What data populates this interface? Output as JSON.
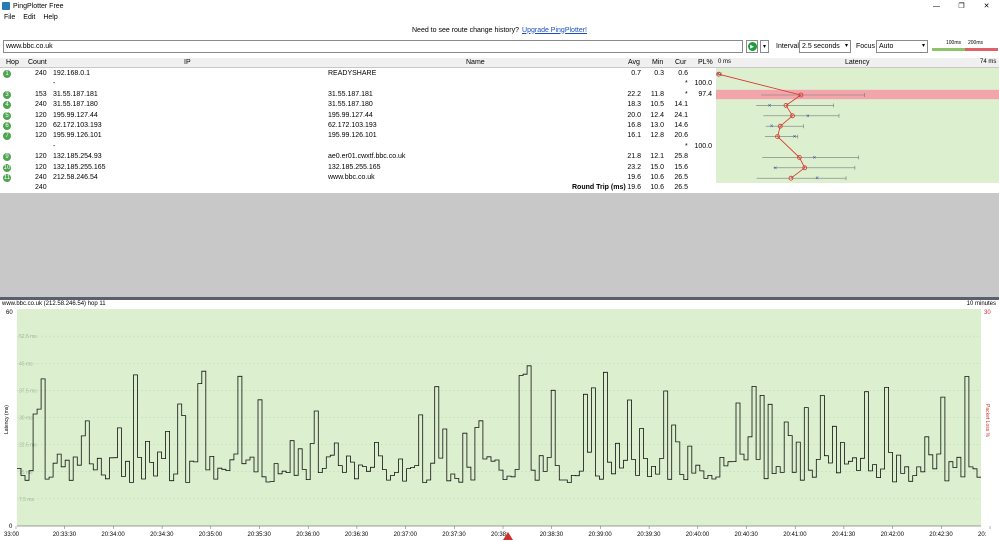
{
  "app": {
    "title": "PingPlotter Free",
    "minimize_glyph": "—",
    "maximize_glyph": "❐",
    "close_glyph": "✕"
  },
  "menu": [
    "File",
    "Edit",
    "Help"
  ],
  "promo": {
    "text": "Need to see route change history?",
    "link": "Upgrade PingPlotter!"
  },
  "toolbar": {
    "target": "www.bbc.co.uk",
    "interval_label": "Interval",
    "interval_value": "2.5 seconds",
    "focus_label": "Focus",
    "focus_value": "Auto",
    "scale_100": "100ms",
    "scale_200": "200ms"
  },
  "table": {
    "headers": [
      "Hop",
      "Count",
      "IP",
      "Name",
      "Avg",
      "Min",
      "Cur",
      "PL%",
      "Latency"
    ],
    "latency_min": "0 ms",
    "latency_max": "74 ms",
    "rows": [
      {
        "hop": "1",
        "count": "240",
        "ip": "192.168.0.1",
        "name": "READYSHARE",
        "avg": "0.7",
        "min": "0.3",
        "cur": "0.6",
        "pl": "",
        "star": ""
      },
      {
        "hop": "",
        "count": "",
        "ip": "-",
        "name": "",
        "avg": "",
        "min": "",
        "cur": "",
        "pl": "100.0",
        "star": "*"
      },
      {
        "hop": "3",
        "count": "153",
        "ip": "31.55.187.181",
        "name": "31.55.187.181",
        "avg": "22.2",
        "min": "11.8",
        "cur": "",
        "pl": "97.4",
        "star": "*"
      },
      {
        "hop": "4",
        "count": "240",
        "ip": "31.55.187.180",
        "name": "31.55.187.180",
        "avg": "18.3",
        "min": "10.5",
        "cur": "14.1",
        "pl": "",
        "star": ""
      },
      {
        "hop": "5",
        "count": "120",
        "ip": "195.99.127.44",
        "name": "195.99.127.44",
        "avg": "20.0",
        "min": "12.4",
        "cur": "24.1",
        "pl": "",
        "star": ""
      },
      {
        "hop": "6",
        "count": "120",
        "ip": "62.172.103.193",
        "name": "62.172.103.193",
        "avg": "16.8",
        "min": "13.0",
        "cur": "14.6",
        "pl": "",
        "star": ""
      },
      {
        "hop": "7",
        "count": "120",
        "ip": "195.99.126.101",
        "name": "195.99.126.101",
        "avg": "16.1",
        "min": "12.8",
        "cur": "20.6",
        "pl": "",
        "star": ""
      },
      {
        "hop": "",
        "count": "",
        "ip": "-",
        "name": "",
        "avg": "",
        "min": "",
        "cur": "",
        "pl": "100.0",
        "star": "*"
      },
      {
        "hop": "9",
        "count": "120",
        "ip": "132.185.254.93",
        "name": "ae0.er01.cwxtf.bbc.co.uk",
        "avg": "21.8",
        "min": "12.1",
        "cur": "25.8",
        "pl": "",
        "star": ""
      },
      {
        "hop": "10",
        "count": "120",
        "ip": "132.185.255.165",
        "name": "132.185.255.165",
        "avg": "23.2",
        "min": "15.0",
        "cur": "15.6",
        "pl": "",
        "star": ""
      },
      {
        "hop": "11",
        "count": "240",
        "ip": "212.58.246.54",
        "name": "www.bbc.co.uk",
        "avg": "19.6",
        "min": "10.6",
        "cur": "26.5",
        "pl": "",
        "star": ""
      }
    ],
    "summary": {
      "count": "240",
      "label": "Round Trip (ms)",
      "avg": "19.6",
      "min": "10.6",
      "cur": "26.5"
    }
  },
  "graph": {
    "title": "www.bbc.co.uk (212.58.246.54) hop 11",
    "range": "10 minutes",
    "y_label": "Latency (ms)",
    "y2_label": "Packet Loss %",
    "y_top": "60",
    "y_bottom": "0",
    "y2_top": "30",
    "gridlines": [
      "52.5 ms",
      "45 ms",
      "37.5 ms",
      "30 ms",
      "22.5 ms",
      "15 ms",
      "7.5 ms"
    ],
    "x_labels": [
      "33:00",
      "20:33:30",
      "20:34:00",
      "20:34:30",
      "20:35:00",
      "20:35:30",
      "20:36:00",
      "20:36:30",
      "20:37:00",
      "20:37:30",
      "20:38:",
      "20:38:30",
      "20:39:00",
      "20:39:30",
      "20:40:00",
      "20:40:30",
      "20:41:00",
      "20:41:30",
      "20:42:00",
      "20:42:30",
      "20:"
    ]
  },
  "colors": {
    "green_badge": "#4ea44f",
    "latency_pane": "#dcf0d0",
    "loss_row": "#f2a5aa",
    "graph_bg": "#dcf0d0",
    "scale_green": "#8cc46a",
    "scale_red": "#e0606a"
  }
}
